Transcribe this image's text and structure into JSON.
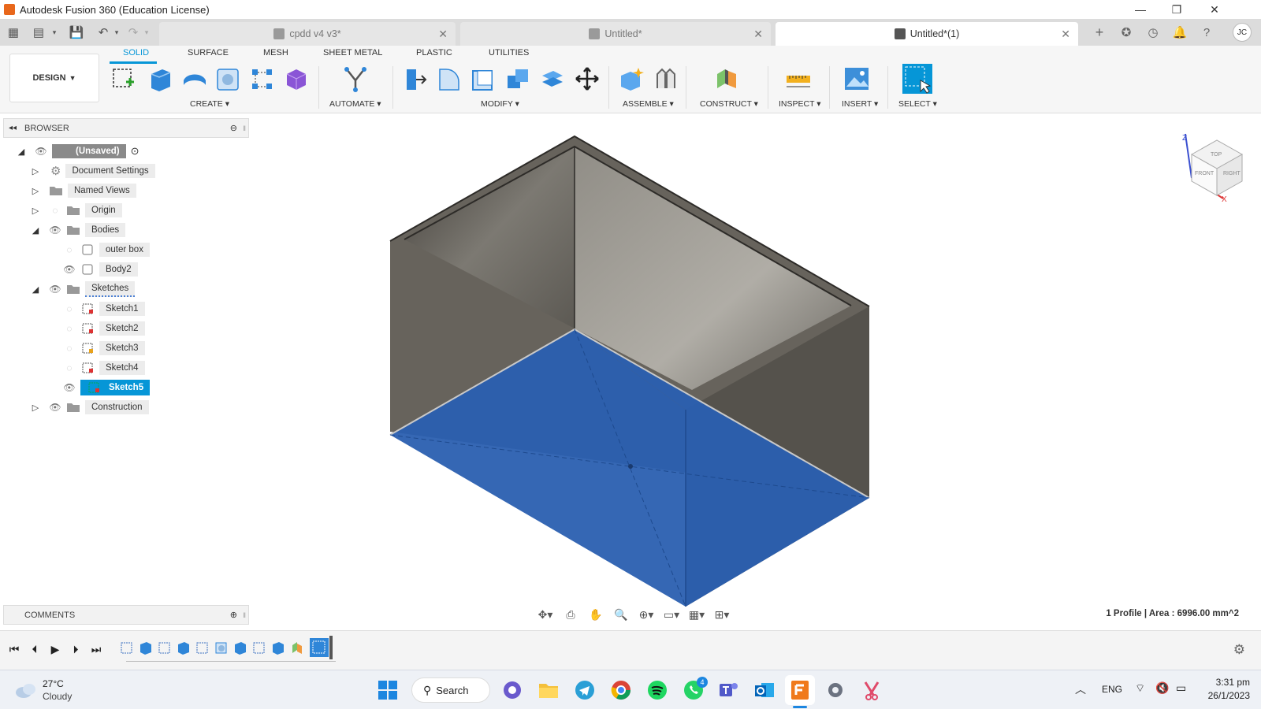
{
  "window": {
    "title": "Autodesk Fusion 360 (Education License)",
    "minimize": "—",
    "maximize": "❐",
    "close": "✕"
  },
  "tabs": [
    {
      "label": "cpdd v4 v3*",
      "active": false
    },
    {
      "label": "Untitled*",
      "active": false
    },
    {
      "label": "Untitled*(1)",
      "active": true
    }
  ],
  "user_initials": "JC",
  "ribbon": {
    "workspace": "DESIGN",
    "tabs": [
      "SOLID",
      "SURFACE",
      "MESH",
      "SHEET METAL",
      "PLASTIC",
      "UTILITIES"
    ],
    "groups": [
      "CREATE",
      "AUTOMATE",
      "MODIFY",
      "ASSEMBLE",
      "CONSTRUCT",
      "INSPECT",
      "INSERT",
      "SELECT"
    ]
  },
  "browser": {
    "title": "BROWSER",
    "root": "(Unsaved)",
    "items": [
      {
        "label": "Document Settings"
      },
      {
        "label": "Named Views"
      },
      {
        "label": "Origin"
      },
      {
        "label": "Bodies"
      },
      {
        "label": "outer box"
      },
      {
        "label": "Body2"
      },
      {
        "label": "Sketches"
      },
      {
        "label": "Sketch1"
      },
      {
        "label": "Sketch2"
      },
      {
        "label": "Sketch3"
      },
      {
        "label": "Sketch4"
      },
      {
        "label": "Sketch5"
      },
      {
        "label": "Construction"
      }
    ]
  },
  "comments": {
    "title": "COMMENTS"
  },
  "viewcube": {
    "top": "TOP",
    "front": "FRONT",
    "right": "RIGHT",
    "axis_z": "Z",
    "axis_x": "X"
  },
  "status": {
    "text": "1 Profile | Area : 6996.00 mm^2"
  },
  "taskbar": {
    "weather_temp": "27°C",
    "weather_desc": "Cloudy",
    "search_label": "Search",
    "lang": "ENG",
    "time": "3:31 pm",
    "date": "26/1/2023",
    "whatsapp_badge": "4"
  },
  "colors": {
    "accent": "#0696d7",
    "selection": "#2a5fb0",
    "box": "#6e6a63"
  }
}
